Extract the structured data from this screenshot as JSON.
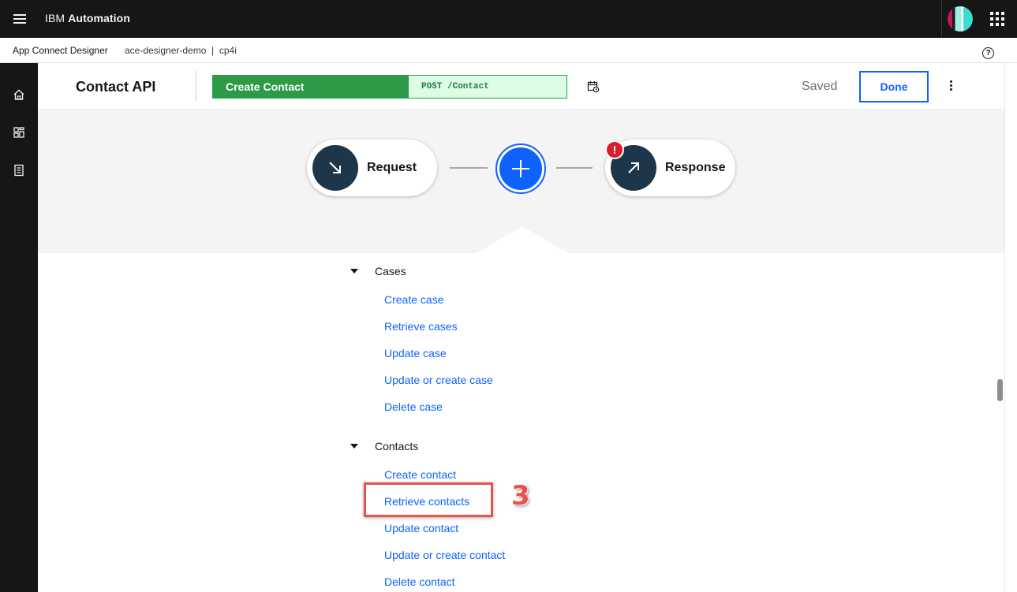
{
  "topbar": {
    "brand_prefix": "IBM",
    "brand_name": "Automation",
    "menu_icon": "hamburger-menu-icon",
    "switcher_icon": "app-switcher-icon"
  },
  "subbar": {
    "app_name": "App Connect Designer",
    "breadcrumb": "ace-designer-demo  |  cp4i",
    "help_glyph": "?"
  },
  "rail": {
    "items": [
      {
        "icon": "home-icon"
      },
      {
        "icon": "catalog-icon"
      },
      {
        "icon": "document-icon"
      }
    ]
  },
  "header": {
    "api_title": "Contact API",
    "flow_name": "Create Contact",
    "flow_route": "POST /Contact",
    "status": "Saved",
    "done_label": "Done"
  },
  "canvas": {
    "request_label": "Request",
    "response_label": "Response",
    "error_glyph": "!"
  },
  "actions": {
    "cases": {
      "heading": "Cases",
      "items": [
        "Create case",
        "Retrieve cases",
        "Update case",
        "Update or create case",
        "Delete case"
      ]
    },
    "contacts": {
      "heading": "Contacts",
      "items": [
        "Create contact",
        "Retrieve contacts",
        "Update contact",
        "Update or create contact",
        "Delete contact"
      ]
    },
    "callout_number": "3"
  },
  "colors": {
    "topbar": "#161616",
    "accent": "#0f62fe",
    "flow_green": "#2e9a47",
    "node_dark": "#1d3649",
    "error_red": "#da1e28",
    "annotation_red": "#e5534b"
  }
}
